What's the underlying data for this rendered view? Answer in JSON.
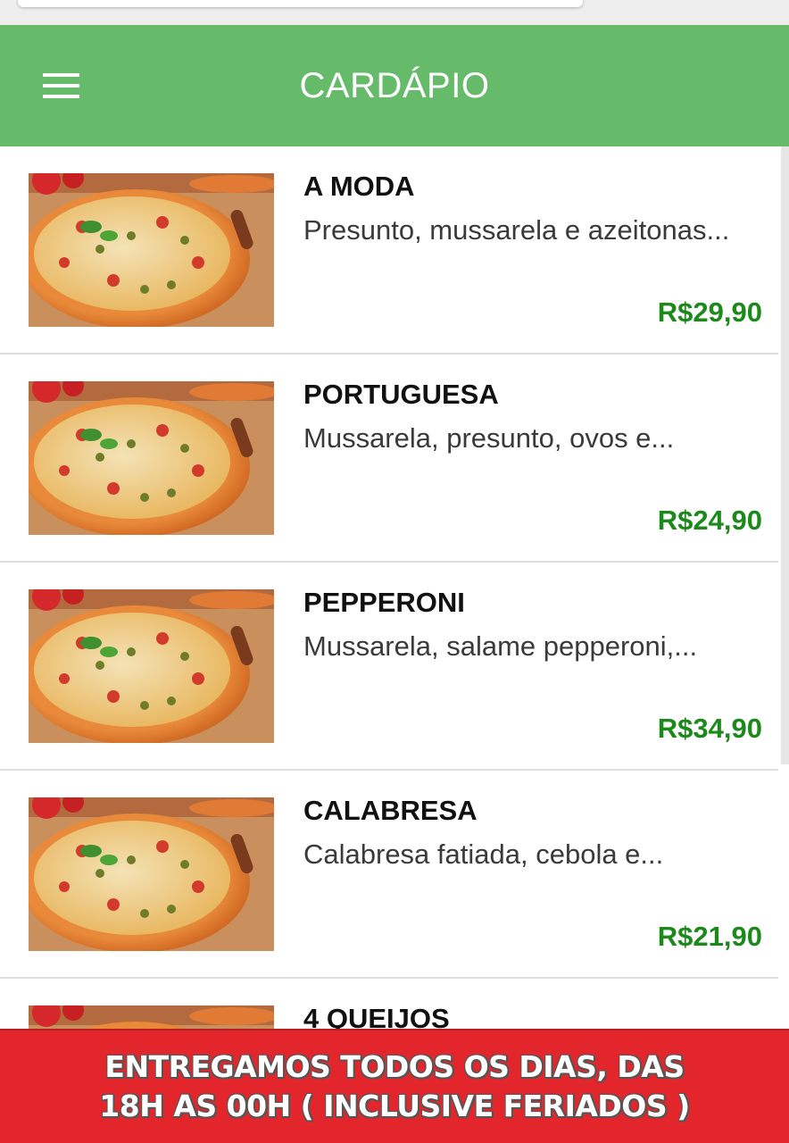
{
  "header": {
    "title": "CARDÁPIO",
    "menu_icon": "hamburger-menu-icon"
  },
  "colors": {
    "appbar": "#66bb6a",
    "price": "#1b8a1b",
    "banner": "#e3262c"
  },
  "menu_items": [
    {
      "name": "A MODA",
      "description": "Presunto, mussarela e azeitonas...",
      "price": "R$29,90",
      "image": "pizza-photo"
    },
    {
      "name": "PORTUGUESA",
      "description": "Mussarela, presunto, ovos e...",
      "price": "R$24,90",
      "image": "pizza-photo"
    },
    {
      "name": "PEPPERONI",
      "description": "Mussarela, salame pepperoni,...",
      "price": "R$34,90",
      "image": "pizza-photo"
    },
    {
      "name": "CALABRESA",
      "description": "Calabresa fatiada, cebola e...",
      "price": "R$21,90",
      "image": "pizza-photo"
    },
    {
      "name": "4 QUEIJOS",
      "description": "",
      "price": "",
      "image": "pizza-photo"
    }
  ],
  "banner": {
    "line1": "ENTREGAMOS TODOS OS DIAS, DAS",
    "line2": "18H AS 00H ( INCLUSIVE FERIADOS )"
  }
}
